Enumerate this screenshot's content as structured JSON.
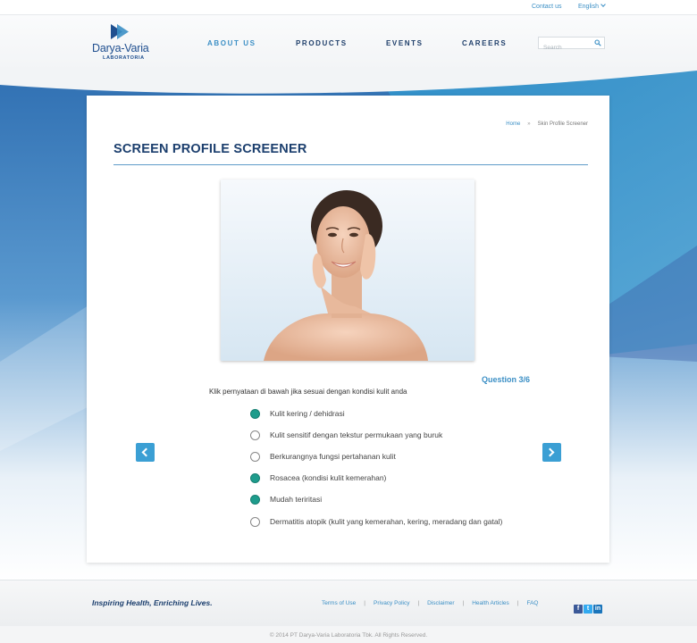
{
  "topbar": {
    "contact_label": "Contact us",
    "language_label": "English"
  },
  "header": {
    "logo": {
      "brand": "Darya-Varia",
      "subtitle": "LABORATORIA"
    },
    "nav": [
      {
        "label": "ABOUT US",
        "active": true
      },
      {
        "label": "PRODUCTS",
        "active": false
      },
      {
        "label": "EVENTS",
        "active": false
      },
      {
        "label": "CAREERS",
        "active": false
      }
    ],
    "search": {
      "placeholder": "Search",
      "value": ""
    }
  },
  "breadcrumb": {
    "home": "Home",
    "separator": "»",
    "current": "Skin Profile Screener"
  },
  "page": {
    "title": "SCREEN PROFILE SCREENER",
    "question_number": "Question 3/6",
    "question_text": "Klik pernyataan di bawah jika sesuai dengan kondisi kulit anda",
    "options": [
      {
        "label": "Kulit kering / dehidrasi",
        "selected": true
      },
      {
        "label": "Kulit sensitif dengan tekstur permukaan yang buruk",
        "selected": false
      },
      {
        "label": "Berkurangnya fungsi pertahanan kulit",
        "selected": false
      },
      {
        "label": "Rosacea (kondisi kulit kemerahan)",
        "selected": true
      },
      {
        "label": "Mudah teriritasi",
        "selected": true
      },
      {
        "label": "Dermatitis atopik (kulit yang kemerahan, kering, meradang dan gatal)",
        "selected": false
      }
    ]
  },
  "footer": {
    "tagline": "Inspiring Health, Enriching Lives.",
    "links": [
      "Terms of Use",
      "Privacy Policy",
      "Disclaimer",
      "Health Articles",
      "FAQ"
    ],
    "social": [
      {
        "icon": "facebook-icon",
        "glyph": "f",
        "color": "#3b5998"
      },
      {
        "icon": "twitter-icon",
        "glyph": "t",
        "color": "#33aaf0"
      },
      {
        "icon": "linkedin-icon",
        "glyph": "in",
        "color": "#1b75bb"
      }
    ],
    "copyright": "© 2014 PT Darya-Varia Laboratoria Tbk. All Rights Reserved."
  },
  "colors": {
    "accent": "#3b8fc5",
    "navy": "#1c3f6e",
    "selected_radio": "#1e9c8c",
    "arrow_button": "#3b9fd4"
  }
}
